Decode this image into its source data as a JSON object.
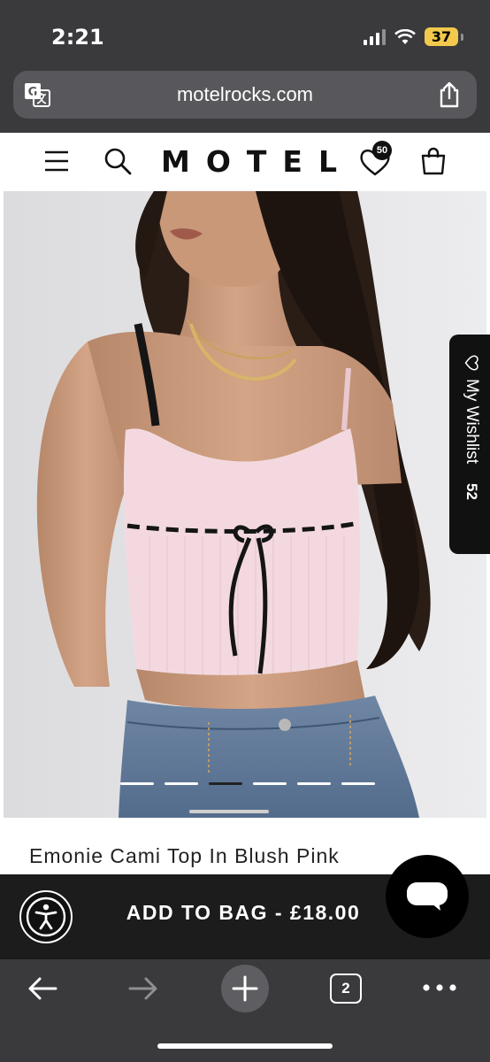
{
  "status_bar": {
    "time": "2:21",
    "battery": "37",
    "icons": [
      "signal-icon",
      "wifi-icon",
      "battery-icon"
    ]
  },
  "browser": {
    "url": "motelrocks.com",
    "left_icon": "translate-icon",
    "right_icon": "share-icon",
    "open_tabs": "2",
    "bottom_icons": [
      "back-arrow-icon",
      "forward-arrow-icon",
      "plus-icon",
      "tabs-icon",
      "more-icon"
    ]
  },
  "header": {
    "logo": "MOTEL",
    "wishlist_badge": "50",
    "icons": [
      "menu-icon",
      "search-icon",
      "heart-icon",
      "bag-icon"
    ]
  },
  "product": {
    "title": "Emonie Cami Top In Blush Pink",
    "carousel_total": 6,
    "carousel_active": 3
  },
  "wishlist_tab": {
    "label": "My Wishlist",
    "count": "52"
  },
  "actions": {
    "add_to_bag": "ADD TO BAG - £18.00",
    "accessibility_icon": "accessibility-icon",
    "chat_icon": "chat-icon"
  },
  "colors": {
    "chrome": "#3a3a3c",
    "bar": "#1c1c1c",
    "top_pink": "#f3d9df",
    "battery": "#f2c94c"
  }
}
